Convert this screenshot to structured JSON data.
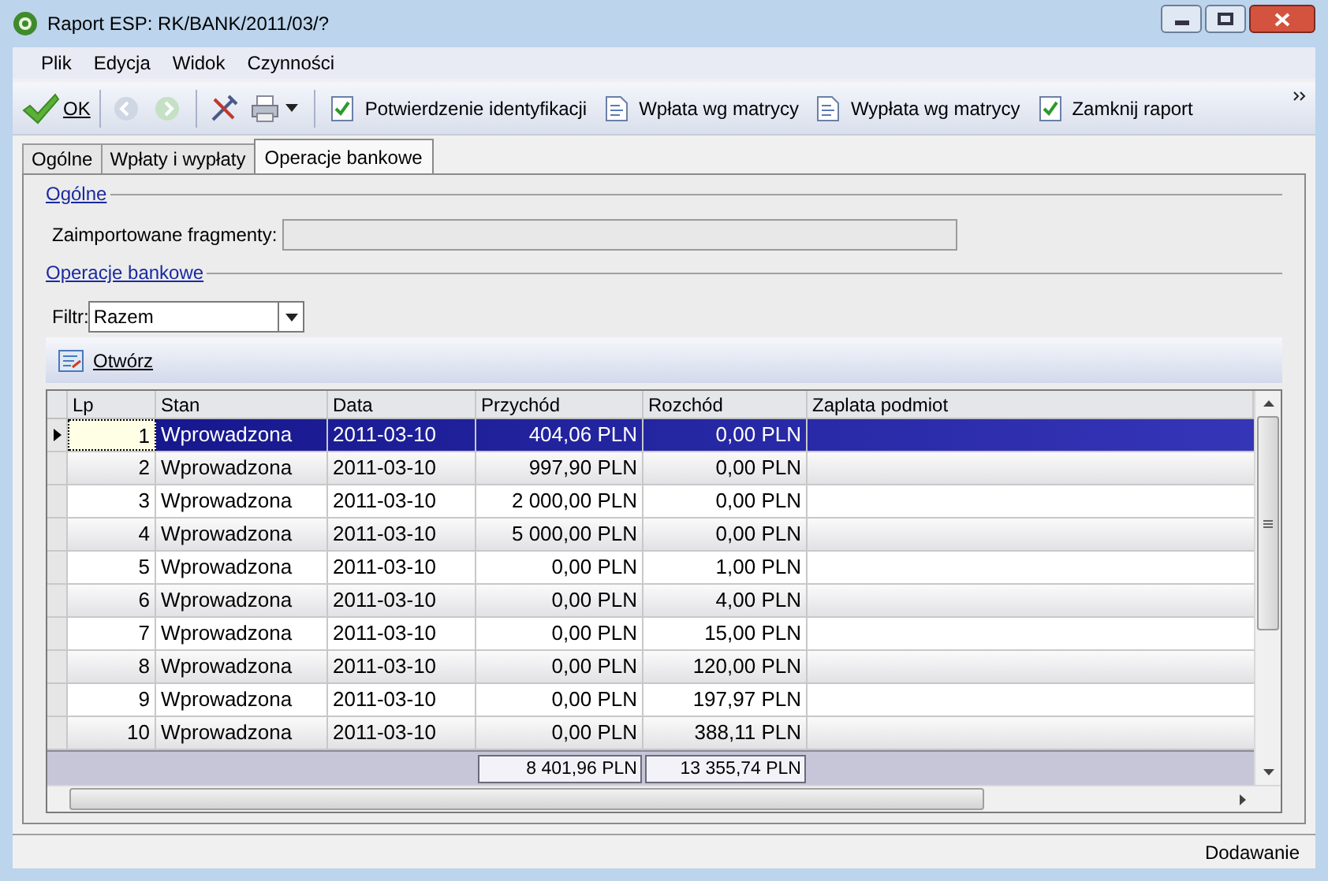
{
  "window": {
    "title": "Raport ESP: RK/BANK/2011/03/?"
  },
  "menu": [
    "Plik",
    "Edycja",
    "Widok",
    "Czynności"
  ],
  "toolbar": {
    "ok": "OK",
    "actions": [
      {
        "label": "Potwierdzenie identyfikacji",
        "kind": "check"
      },
      {
        "label": "Wpłata wg matrycy",
        "kind": "doc"
      },
      {
        "label": "Wypłata wg matrycy",
        "kind": "doc"
      },
      {
        "label": "Zamknij raport",
        "kind": "check"
      }
    ]
  },
  "tabs": [
    {
      "label": "Ogólne",
      "selected": false
    },
    {
      "label": "Wpłaty i wypłaty",
      "selected": false
    },
    {
      "label": "Operacje bankowe",
      "selected": true
    }
  ],
  "general": {
    "title": "Ogólne",
    "field_label": "Zaimportowane fragmenty:"
  },
  "operations": {
    "title": "Operacje bankowe",
    "filter_label": "Filtr:",
    "filter_value": "Razem",
    "open_button": "Otwórz"
  },
  "table": {
    "columns": [
      "Lp",
      "Stan",
      "Data",
      "Przychód",
      "Rozchód",
      "Zaplata podmiot"
    ],
    "rows": [
      {
        "cells": [
          "1",
          "Wprowadzona",
          "2011-03-10",
          "404,06 PLN",
          "0,00 PLN"
        ],
        "selected": true
      },
      {
        "cells": [
          "2",
          "Wprowadzona",
          "2011-03-10",
          "997,90 PLN",
          "0,00 PLN"
        ],
        "selected": false
      },
      {
        "cells": [
          "3",
          "Wprowadzona",
          "2011-03-10",
          "2 000,00 PLN",
          "0,00 PLN"
        ],
        "selected": false
      },
      {
        "cells": [
          "4",
          "Wprowadzona",
          "2011-03-10",
          "5 000,00 PLN",
          "0,00 PLN"
        ],
        "selected": false
      },
      {
        "cells": [
          "5",
          "Wprowadzona",
          "2011-03-10",
          "0,00 PLN",
          "1,00 PLN"
        ],
        "selected": false
      },
      {
        "cells": [
          "6",
          "Wprowadzona",
          "2011-03-10",
          "0,00 PLN",
          "4,00 PLN"
        ],
        "selected": false
      },
      {
        "cells": [
          "7",
          "Wprowadzona",
          "2011-03-10",
          "0,00 PLN",
          "15,00 PLN"
        ],
        "selected": false
      },
      {
        "cells": [
          "8",
          "Wprowadzona",
          "2011-03-10",
          "0,00 PLN",
          "120,00 PLN"
        ],
        "selected": false
      },
      {
        "cells": [
          "9",
          "Wprowadzona",
          "2011-03-10",
          "0,00 PLN",
          "197,97 PLN"
        ],
        "selected": false
      },
      {
        "cells": [
          "10",
          "Wprowadzona",
          "2011-03-10",
          "0,00 PLN",
          "388,11 PLN"
        ],
        "selected": false
      }
    ],
    "totals": [
      "8 401,96 PLN",
      "13 355,74 PLN"
    ]
  },
  "status_bar": "Dodawanie"
}
